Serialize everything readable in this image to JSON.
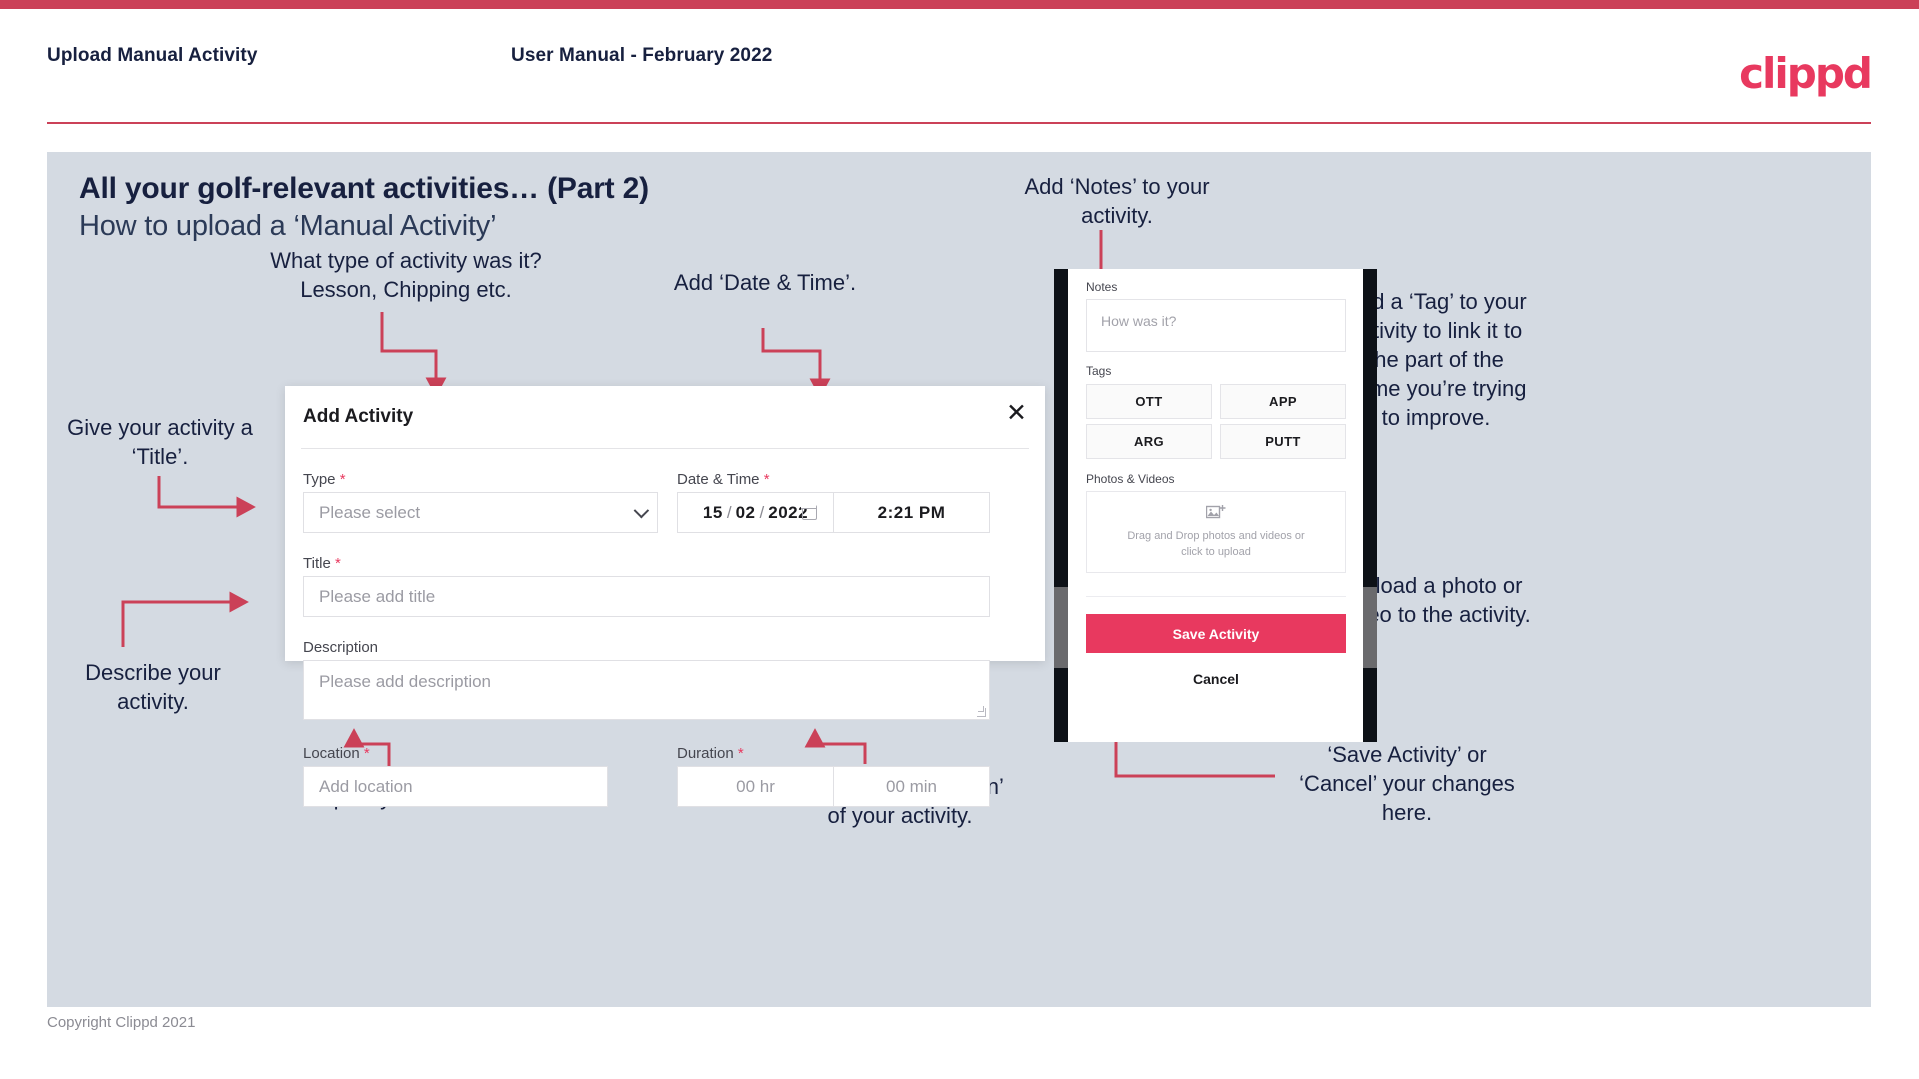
{
  "header": {
    "left_title": "Upload Manual Activity",
    "center_title": "User Manual - February 2022",
    "logo": "clippd",
    "accent_color": "#cb4158"
  },
  "slide": {
    "title": "All your golf-relevant activities… (Part 2)",
    "subtitle": "How to upload a ‘Manual Activity’",
    "background": "#d4dae2"
  },
  "annotations": {
    "type": "What type of activity was it?\nLesson, Chipping etc.",
    "datetime": "Add ‘Date & Time’.",
    "title": "Give your activity a\n‘Title’.",
    "description": "Describe your\nactivity.",
    "location": "Specify the ‘Location’.",
    "duration": "Specify the ‘Duration’\nof your activity.",
    "notes": "Add ‘Notes’ to your\nactivity.",
    "tags": "Add a ‘Tag’ to your\nactivity to link it to\nthe part of the\ngame you’re trying\nto improve.",
    "upload": "Upload a photo or\nvideo to the activity.",
    "save": "‘Save Activity’ or\n‘Cancel’ your changes\nhere."
  },
  "dialog": {
    "title": "Add Activity",
    "close_icon": "close-icon",
    "fields": {
      "type": {
        "label": "Type",
        "required": true,
        "placeholder": "Please select",
        "icon": "chevron-down-icon"
      },
      "datetime": {
        "label": "Date & Time",
        "required": true,
        "day": "15",
        "month": "02",
        "year": "2022",
        "sep": "/",
        "time": "2:21 PM",
        "icon": "calendar-icon"
      },
      "title": {
        "label": "Title",
        "required": true,
        "placeholder": "Please add title"
      },
      "description": {
        "label": "Description",
        "required": false,
        "placeholder": "Please add description"
      },
      "location": {
        "label": "Location",
        "required": true,
        "placeholder": "Add location"
      },
      "duration": {
        "label": "Duration",
        "required": true,
        "hours": "00 hr",
        "minutes": "00 min"
      }
    }
  },
  "phone": {
    "notes": {
      "label": "Notes",
      "placeholder": "How was it?"
    },
    "tags": {
      "label": "Tags",
      "items": [
        "OTT",
        "APP",
        "ARG",
        "PUTT"
      ]
    },
    "media": {
      "label": "Photos & Videos",
      "icon": "add-image-icon",
      "dropzone_line1": "Drag and Drop photos and videos or",
      "dropzone_line2": "click to upload"
    },
    "save_label": "Save Activity",
    "cancel_label": "Cancel",
    "save_color": "#e8395f"
  },
  "footer": {
    "copyright": "Copyright Clippd 2021"
  }
}
